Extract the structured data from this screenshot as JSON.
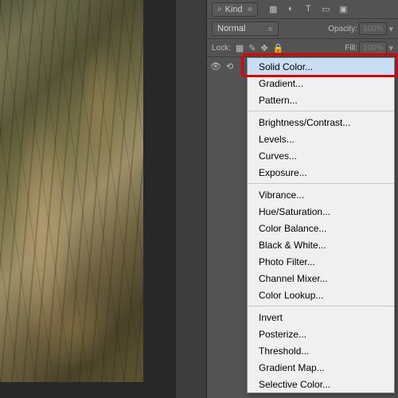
{
  "layers": {
    "filter": {
      "search_glyph": "⌕",
      "label": "Kind",
      "chevron": "≑"
    },
    "type_icons": {
      "pixel": "▦",
      "adjust": "◐",
      "type": "T",
      "shape": "▭",
      "smart": "▣"
    },
    "blend": {
      "mode": "Normal",
      "chevron": "≑"
    },
    "opacity": {
      "label": "Opacity:",
      "value": "100%"
    },
    "lock": {
      "label": "Lock:",
      "icons": {
        "trans": "▦",
        "pixels": "✎",
        "pos": "✥",
        "all": "🔒"
      }
    },
    "fill": {
      "label": "Fill:",
      "value": "100%"
    },
    "layer_eye": "👁"
  },
  "menu": {
    "sections": [
      [
        "Solid Color...",
        "Gradient...",
        "Pattern..."
      ],
      [
        "Brightness/Contrast...",
        "Levels...",
        "Curves...",
        "Exposure..."
      ],
      [
        "Vibrance...",
        "Hue/Saturation...",
        "Color Balance...",
        "Black & White...",
        "Photo Filter...",
        "Channel Mixer...",
        "Color Lookup..."
      ],
      [
        "Invert",
        "Posterize...",
        "Threshold...",
        "Gradient Map...",
        "Selective Color..."
      ]
    ],
    "highlighted": "Solid Color..."
  }
}
